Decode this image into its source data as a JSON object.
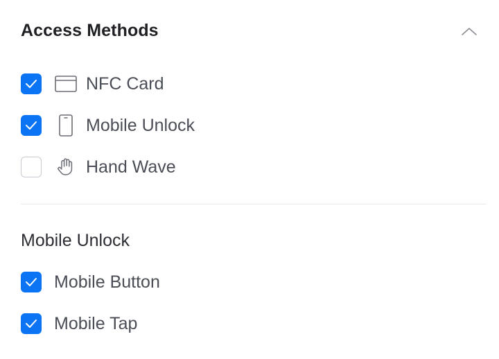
{
  "access_methods": {
    "title": "Access Methods",
    "collapse_icon": "chevron-up-icon",
    "items": [
      {
        "label": "NFC Card",
        "checked": true,
        "icon": "card-icon"
      },
      {
        "label": "Mobile Unlock",
        "checked": true,
        "icon": "phone-icon"
      },
      {
        "label": "Hand Wave",
        "checked": false,
        "icon": "hand-icon"
      }
    ]
  },
  "mobile_unlock": {
    "title": "Mobile Unlock",
    "items": [
      {
        "label": "Mobile Button",
        "checked": true
      },
      {
        "label": "Mobile Tap",
        "checked": true
      }
    ]
  },
  "colors": {
    "accent": "#0a74f5",
    "text": "#4a4d55",
    "heading": "#1f2024",
    "divider": "#e8e9ec"
  }
}
